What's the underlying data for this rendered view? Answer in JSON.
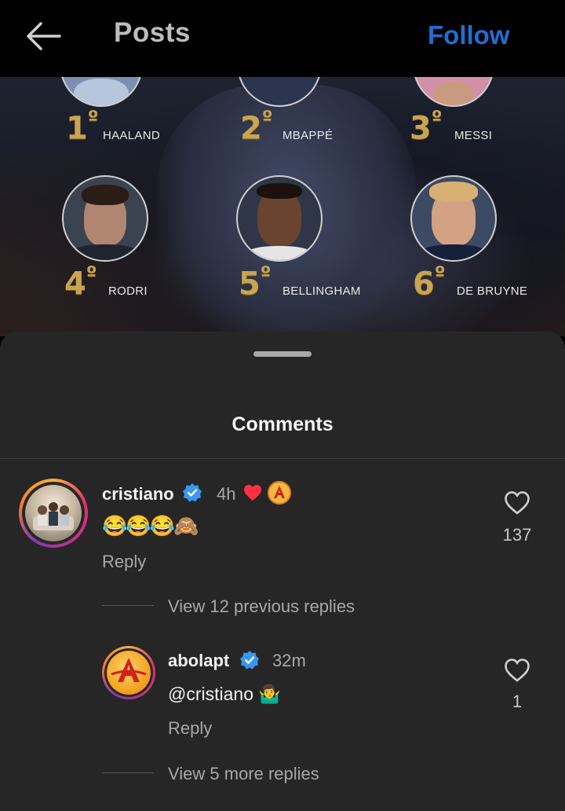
{
  "header": {
    "back_icon": "arrow-left-icon",
    "title": "Posts",
    "follow_label": "Follow"
  },
  "post_ranking": [
    {
      "rank": "1",
      "suffix": "º",
      "name": "HAALAND"
    },
    {
      "rank": "2",
      "suffix": "º",
      "name": "MBAPPÉ"
    },
    {
      "rank": "3",
      "suffix": "º",
      "name": "MESSI"
    },
    {
      "rank": "4",
      "suffix": "º",
      "name": "RODRI"
    },
    {
      "rank": "5",
      "suffix": "º",
      "name": "BELLINGHAM"
    },
    {
      "rank": "6",
      "suffix": "º",
      "name": "DE BRUYNE"
    }
  ],
  "comments_sheet": {
    "title": "Comments"
  },
  "comments": [
    {
      "username": "cristiano",
      "verified": true,
      "time": "4h",
      "text_emojis": "😂😂😂🙈",
      "reply_label": "Reply",
      "like_count": "137",
      "view_replies": "View 12 previous replies"
    },
    {
      "username": "abolapt",
      "verified": true,
      "time": "32m",
      "text": "@cristiano",
      "text_emoji": "🤷‍♂️",
      "reply_label": "Reply",
      "like_count": "1",
      "view_replies": "View 5 more replies"
    }
  ],
  "colors": {
    "follow": "#1f6fd1",
    "sheet_bg": "#262626",
    "verified": "#3897f0",
    "rank_gold": "#c9a451"
  }
}
